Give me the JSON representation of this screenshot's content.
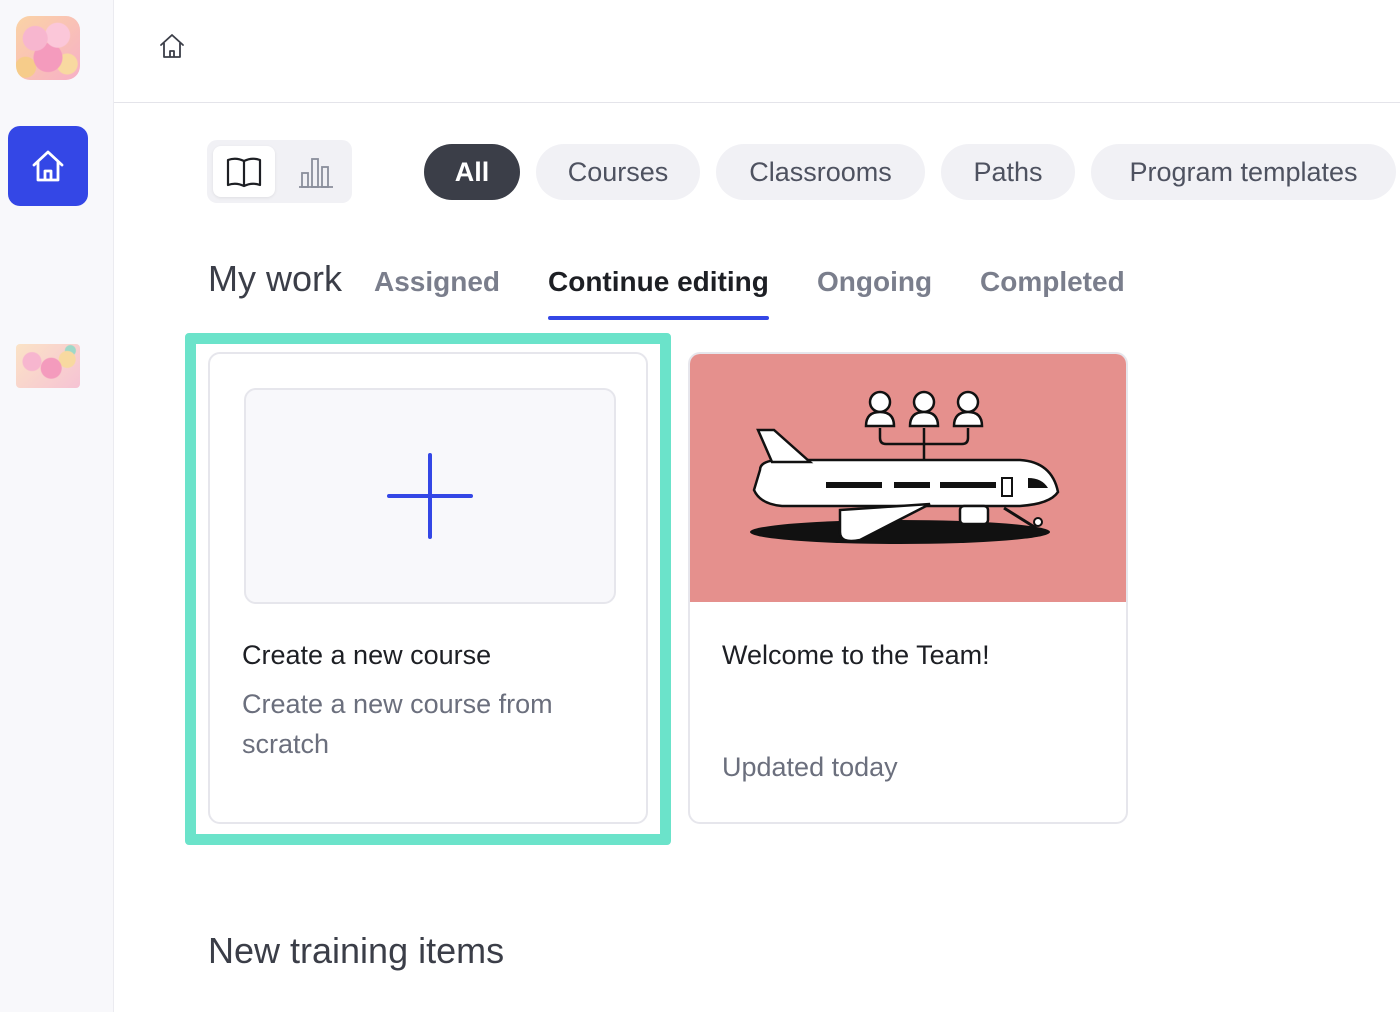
{
  "sidebar": {
    "icons": [
      "workspace-avatar",
      "home-icon",
      "course-thumbnail"
    ]
  },
  "view_toggle": {
    "options": [
      "book-icon",
      "bar-chart-icon"
    ],
    "selected": "book-icon"
  },
  "filters": {
    "items": [
      {
        "label": "All",
        "active": true
      },
      {
        "label": "Courses",
        "active": false
      },
      {
        "label": "Classrooms",
        "active": false
      },
      {
        "label": "Paths",
        "active": false
      },
      {
        "label": "Program templates",
        "active": false
      }
    ]
  },
  "my_work": {
    "heading": "My work",
    "tabs": [
      {
        "label": "Assigned",
        "active": false
      },
      {
        "label": "Continue editing",
        "active": true
      },
      {
        "label": "Ongoing",
        "active": false
      },
      {
        "label": "Completed",
        "active": false
      }
    ]
  },
  "cards": {
    "new_course": {
      "title": "Create a new course",
      "description": "Create a new course from scratch"
    },
    "team": {
      "title": "Welcome to the Team!",
      "updated": "Updated today"
    }
  },
  "new_training": {
    "heading": "New training items"
  },
  "colors": {
    "accent": "#3447e6",
    "highlight": "#6be3ca",
    "active_chip": "#3b3e48",
    "card_image_bg": "#e5908d"
  }
}
